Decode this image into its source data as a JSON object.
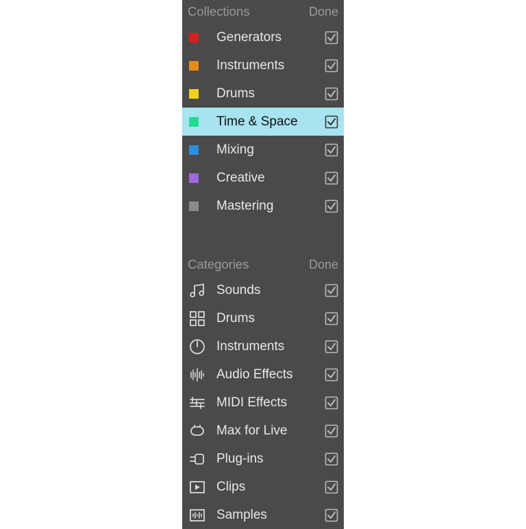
{
  "collections": {
    "header": "Collections",
    "done": "Done",
    "items": [
      {
        "label": "Generators",
        "color": "#d32020",
        "checked": true,
        "selected": false
      },
      {
        "label": "Instruments",
        "color": "#e78a1e",
        "checked": true,
        "selected": false
      },
      {
        "label": "Drums",
        "color": "#f2d11a",
        "checked": true,
        "selected": false
      },
      {
        "label": "Time & Space",
        "color": "#1fdc8e",
        "checked": true,
        "selected": true
      },
      {
        "label": "Mixing",
        "color": "#2b8fe0",
        "checked": true,
        "selected": false
      },
      {
        "label": "Creative",
        "color": "#a066e0",
        "checked": true,
        "selected": false
      },
      {
        "label": "Mastering",
        "color": "#8a8a8a",
        "checked": true,
        "selected": false
      }
    ]
  },
  "categories": {
    "header": "Categories",
    "done": "Done",
    "items": [
      {
        "label": "Sounds",
        "icon": "sounds-icon",
        "checked": true
      },
      {
        "label": "Drums",
        "icon": "drums-icon",
        "checked": true
      },
      {
        "label": "Instruments",
        "icon": "instruments-icon",
        "checked": true
      },
      {
        "label": "Audio Effects",
        "icon": "audio-effects-icon",
        "checked": true
      },
      {
        "label": "MIDI Effects",
        "icon": "midi-effects-icon",
        "checked": true
      },
      {
        "label": "Max for Live",
        "icon": "max-for-live-icon",
        "checked": true
      },
      {
        "label": "Plug-ins",
        "icon": "plug-ins-icon",
        "checked": true
      },
      {
        "label": "Clips",
        "icon": "clips-icon",
        "checked": true
      },
      {
        "label": "Samples",
        "icon": "samples-icon",
        "checked": true
      }
    ]
  }
}
